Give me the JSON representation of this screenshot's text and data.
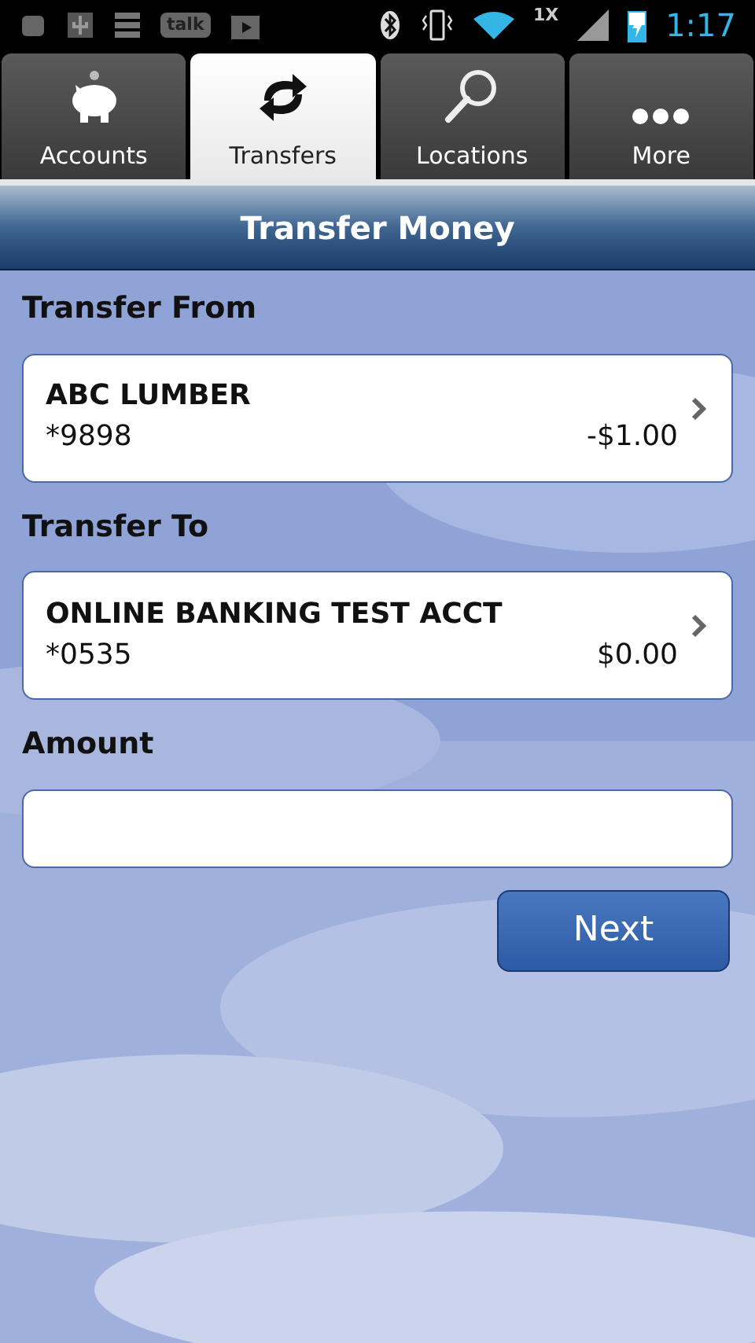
{
  "status_bar": {
    "talk_label": "talk",
    "network": "1X",
    "time": "1:17"
  },
  "tabs": [
    {
      "label": "Accounts",
      "kind": "piggy",
      "selected": false
    },
    {
      "label": "Transfers",
      "kind": "transfer",
      "selected": true
    },
    {
      "label": "Locations",
      "kind": "search",
      "selected": false
    },
    {
      "label": "More",
      "kind": "more",
      "selected": false
    }
  ],
  "header": {
    "title": "Transfer Money"
  },
  "sections": [
    {
      "label": "Transfer From",
      "kind": "account",
      "name": "ABC LUMBER",
      "number": "*9898",
      "balance": "-$1.00"
    },
    {
      "label": "Transfer To",
      "kind": "account",
      "name": "ONLINE BANKING TEST ACCT",
      "number": "*0535",
      "balance": "$0.00"
    },
    {
      "label": "Amount",
      "kind": "field"
    }
  ],
  "next_button": "Next"
}
